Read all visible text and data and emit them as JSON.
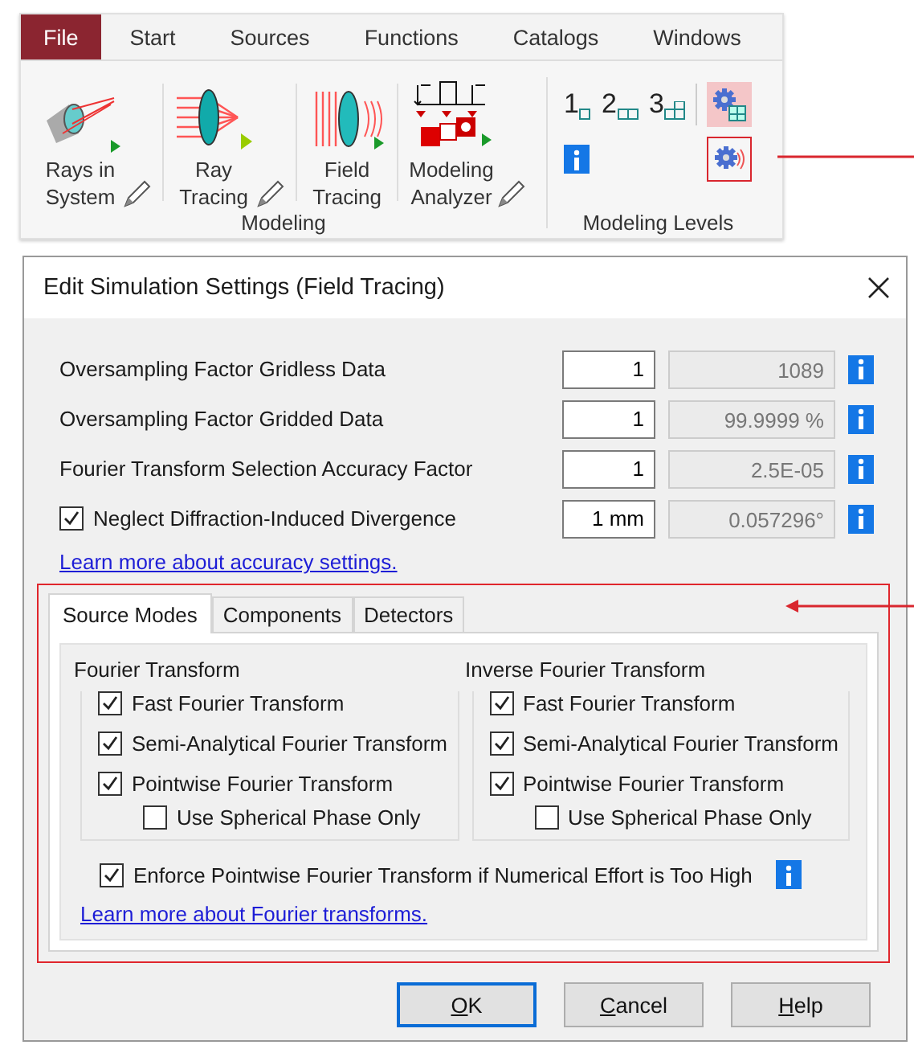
{
  "menu": [
    {
      "label": "File",
      "selected": true
    },
    {
      "label": "Start",
      "selected": false
    },
    {
      "label": "Sources",
      "selected": false
    },
    {
      "label": "Functions",
      "selected": false
    },
    {
      "label": "Catalogs",
      "selected": false
    },
    {
      "label": "Windows",
      "selected": false
    }
  ],
  "ribbon": {
    "modeling": {
      "title": "Modeling",
      "buttons": [
        {
          "lines": [
            "Rays in",
            "System"
          ],
          "kind": "rays",
          "editable": true
        },
        {
          "lines": [
            "Ray",
            "Tracing"
          ],
          "kind": "lens",
          "editable": true
        },
        {
          "lines": [
            "Field",
            "Tracing"
          ],
          "kind": "field",
          "editable": false
        },
        {
          "lines": [
            "Modeling",
            "Analyzer"
          ],
          "kind": "analyzer",
          "editable": true
        }
      ]
    },
    "levels": {
      "title": "Modeling Levels",
      "numbers": [
        "1",
        "2",
        "3"
      ],
      "tools": [
        {
          "kind": "gear-grid",
          "selected": true,
          "annotated": false
        },
        {
          "kind": "info"
        },
        {
          "kind": "gear-wave",
          "selected": false,
          "annotated": true
        }
      ]
    }
  },
  "dialog": {
    "title": "Edit Simulation Settings (Field Tracing)",
    "settings": [
      {
        "kind": "plain",
        "label": "Oversampling Factor Gridless Data",
        "value": "1",
        "readout": "1089"
      },
      {
        "kind": "plain",
        "label": "Oversampling Factor Gridded Data",
        "value": "1",
        "readout": "99.9999 %"
      },
      {
        "kind": "plain",
        "label": "Fourier Transform Selection Accuracy Factor",
        "value": "1",
        "readout": "2.5E-05"
      },
      {
        "kind": "check",
        "label": "Neglect Diffraction-Induced Divergence",
        "checked": true,
        "value": "1 mm",
        "readout": "0.057296°"
      }
    ],
    "accuracy_link": "Learn more about accuracy settings.",
    "tabs": [
      {
        "label": "Source Modes",
        "selected": true
      },
      {
        "label": "Components",
        "selected": false
      },
      {
        "label": "Detectors",
        "selected": false
      }
    ],
    "groups": [
      {
        "title": "Fourier Transform",
        "options": [
          {
            "label": "Fast Fourier Transform",
            "checked": true
          },
          {
            "label": "Semi-Analytical Fourier Transform",
            "checked": true
          },
          {
            "label": "Pointwise Fourier Transform",
            "checked": true,
            "children": [
              {
                "label": "Use Spherical Phase Only",
                "checked": false
              }
            ]
          }
        ]
      },
      {
        "title": "Inverse Fourier Transform",
        "options": [
          {
            "label": "Fast Fourier Transform",
            "checked": true
          },
          {
            "label": "Semi-Analytical Fourier Transform",
            "checked": true
          },
          {
            "label": "Pointwise Fourier Transform",
            "checked": true,
            "children": [
              {
                "label": "Use Spherical Phase Only",
                "checked": false
              }
            ]
          }
        ]
      }
    ],
    "enforce": {
      "label": "Enforce Pointwise Fourier Transform if Numerical Effort is Too High",
      "checked": true
    },
    "fourier_link": "Learn more about Fourier transforms.",
    "buttons": [
      {
        "key": "O",
        "rest": "K",
        "default": true
      },
      {
        "key": "C",
        "rest": "ancel",
        "default": false
      },
      {
        "key": "H",
        "rest": "elp",
        "default": false
      }
    ]
  }
}
